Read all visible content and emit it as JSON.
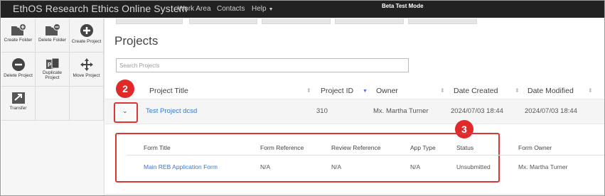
{
  "navbar": {
    "brand": "EthOS Research Ethics Online System",
    "links": [
      "Work Area",
      "Contacts",
      "Help"
    ],
    "mode": "Beta Test Mode"
  },
  "toolbar": {
    "tools": [
      {
        "label": "Create Folder",
        "icon": "create-folder-icon"
      },
      {
        "label": "Delete Folder",
        "icon": "delete-folder-icon"
      },
      {
        "label": "Create Project",
        "icon": "create-project-icon"
      },
      {
        "label": "Delete Project",
        "icon": "delete-project-icon"
      },
      {
        "label": "Duplicate Project",
        "icon": "duplicate-project-icon"
      },
      {
        "label": "Move Project",
        "icon": "move-project-icon"
      },
      {
        "label": "Transfer",
        "icon": "transfer-icon"
      }
    ]
  },
  "page": {
    "title": "Projects",
    "search_placeholder": "Search Projects"
  },
  "projects_table": {
    "columns": [
      "Project Title",
      "Project ID",
      "Owner",
      "Date Created",
      "Date Modified"
    ],
    "rows": [
      {
        "title": "Test Project dcsd",
        "id": "310",
        "owner": "Mx. Martha Turner",
        "created": "2024/07/03 18:44",
        "modified": "2024/07/03 18:44"
      }
    ]
  },
  "forms_table": {
    "columns": [
      "Form Title",
      "Form Reference",
      "Review Reference",
      "App Type",
      "Status",
      "Form Owner"
    ],
    "rows": [
      {
        "title": "Main REB Application Form",
        "form_ref": "N/A",
        "review_ref": "N/A",
        "app_type": "N/A",
        "status": "Unsubmitted",
        "owner": "Mx. Martha Turner"
      }
    ]
  },
  "callouts": [
    "2",
    "3"
  ],
  "colors": {
    "navbar": "#222222",
    "accent_link": "#3a78c3",
    "highlight": "#d93636",
    "sort_active": "#5a6bd6"
  }
}
